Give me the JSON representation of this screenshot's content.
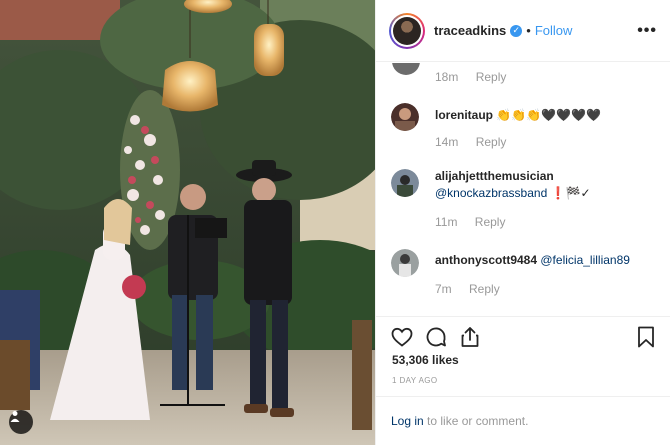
{
  "post": {
    "username": "traceadkins",
    "follow_label": "Follow",
    "separator": "•",
    "more_label": "•••",
    "likes": "53,306 likes",
    "time_ago": "1 DAY AGO",
    "login_link": "Log in",
    "login_rest": "to like or comment."
  },
  "comments": {
    "first_partial": {
      "time": "18m",
      "reply": "Reply"
    },
    "items": [
      {
        "username": "lorenitaup",
        "text": "👏👏👏🖤🖤🖤🖤",
        "time": "14m",
        "reply": "Reply"
      },
      {
        "username": "alijahjettthemusician",
        "mention": "@knockazbrassband",
        "text": " ❗🏁✓",
        "time": "11m",
        "reply": "Reply"
      },
      {
        "username": "anthonyscott9484",
        "mention": "@felicia_lillian89",
        "text": "",
        "time": "7m",
        "reply": "Reply"
      }
    ]
  },
  "icons": {
    "like": "heart-icon",
    "comment": "comment-bubble-icon",
    "share": "share-icon",
    "save": "bookmark-icon",
    "tag": "user-tag-icon"
  },
  "colors": {
    "link": "#3897f0",
    "text": "#262626",
    "muted": "#999999",
    "border": "#efefef"
  }
}
